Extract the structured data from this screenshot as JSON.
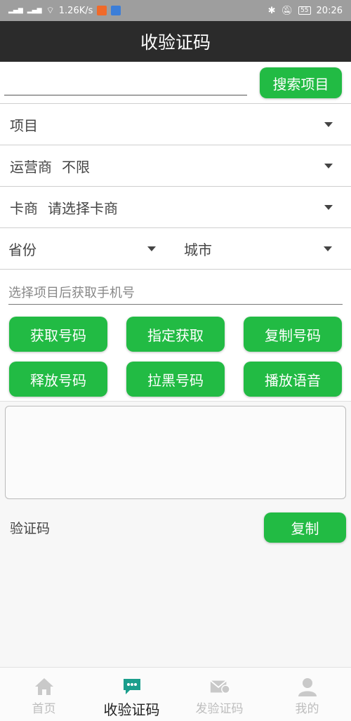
{
  "status_bar": {
    "network_speed": "1.26K/s",
    "battery": "55",
    "time": "20:26"
  },
  "header": {
    "title": "收验证码"
  },
  "search": {
    "input_value": "",
    "button_label": "搜索项目"
  },
  "filters": {
    "project_label": "项目",
    "operator_label": "运营商",
    "operator_value": "不限",
    "card_label": "卡商",
    "card_value": "请选择卡商",
    "province_label": "省份",
    "city_label": "城市"
  },
  "phone": {
    "placeholder": "选择项目后获取手机号"
  },
  "actions": {
    "get_number": "获取号码",
    "assign_get": "指定获取",
    "copy_number": "复制号码",
    "release_number": "释放号码",
    "blacklist_number": "拉黑号码",
    "play_voice": "播放语音"
  },
  "message": {
    "content": ""
  },
  "code": {
    "label": "验证码",
    "copy_label": "复制"
  },
  "nav": {
    "items": [
      {
        "label": "首页",
        "icon": "home-icon",
        "active": false
      },
      {
        "label": "收验证码",
        "icon": "chat-icon",
        "active": true
      },
      {
        "label": "发验证码",
        "icon": "send-mail-icon",
        "active": false
      },
      {
        "label": "我的",
        "icon": "user-icon",
        "active": false
      }
    ]
  },
  "colors": {
    "accent": "#22bb44",
    "header_bg": "#2b2b2b",
    "active_nav_icon": "#1a9e8c"
  }
}
